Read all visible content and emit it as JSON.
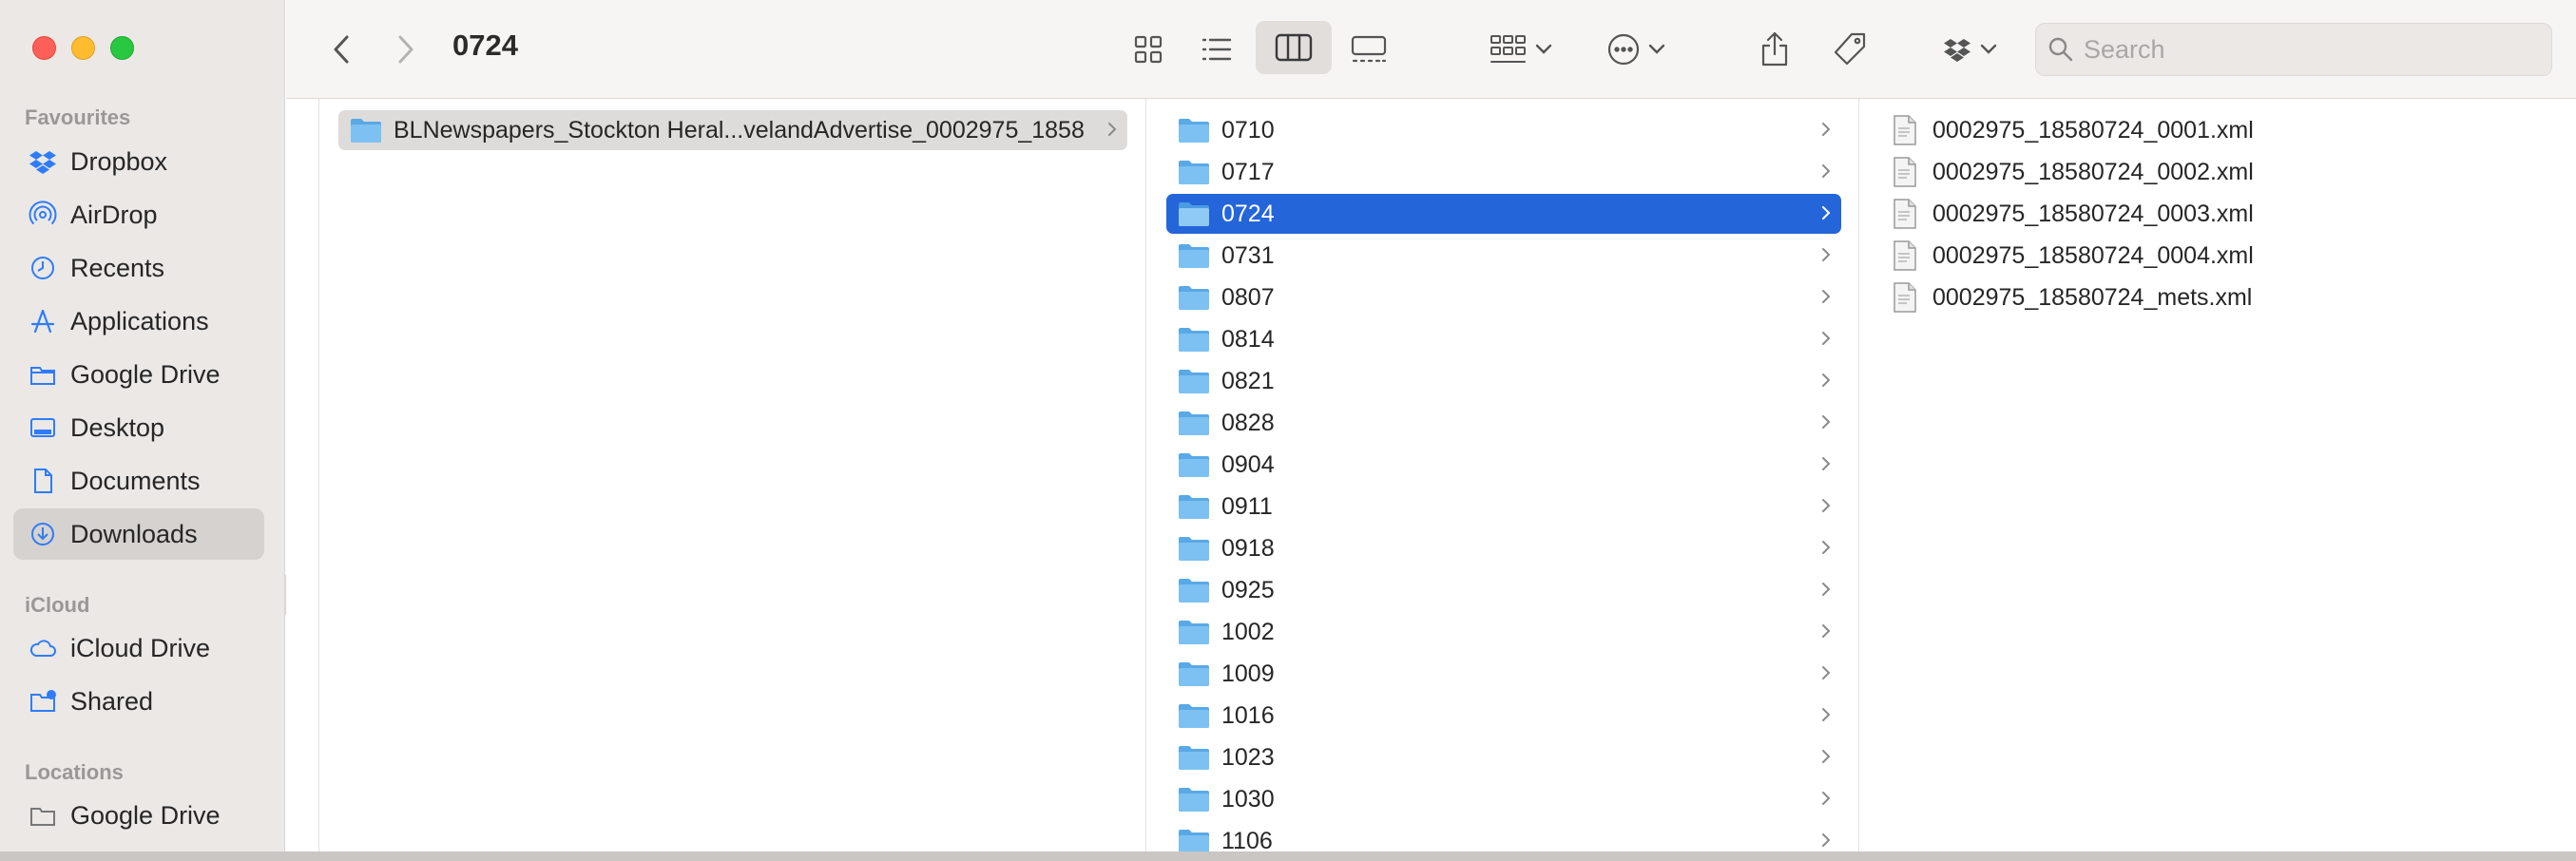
{
  "window": {
    "title": "0724"
  },
  "sidebar": {
    "sections": [
      {
        "heading": "Favourites",
        "items": [
          {
            "label": "Dropbox",
            "icon": "dropbox-icon"
          },
          {
            "label": "AirDrop",
            "icon": "airdrop-icon"
          },
          {
            "label": "Recents",
            "icon": "clock-icon"
          },
          {
            "label": "Applications",
            "icon": "applications-icon"
          },
          {
            "label": "Google Drive",
            "icon": "folder-icon"
          },
          {
            "label": "Desktop",
            "icon": "desktop-icon"
          },
          {
            "label": "Documents",
            "icon": "document-icon"
          },
          {
            "label": "Downloads",
            "icon": "download-icon",
            "selected": true
          }
        ]
      },
      {
        "heading": "iCloud",
        "items": [
          {
            "label": "iCloud Drive",
            "icon": "cloud-icon"
          },
          {
            "label": "Shared",
            "icon": "shared-folder-icon"
          }
        ]
      },
      {
        "heading": "Locations",
        "items": [
          {
            "label": "Google Drive",
            "icon": "drive-icon"
          }
        ]
      }
    ]
  },
  "toolbar": {
    "search_placeholder": "Search"
  },
  "columns": {
    "parent": {
      "items": [
        {
          "name": "BLNewspapers_Stockton Heral...velandAdvertise_0002975_1858",
          "selected": true
        }
      ]
    },
    "months": {
      "items": [
        "0710",
        "0717",
        "0724",
        "0731",
        "0807",
        "0814",
        "0821",
        "0828",
        "0904",
        "0911",
        "0918",
        "0925",
        "1002",
        "1009",
        "1016",
        "1023",
        "1030",
        "1106"
      ],
      "selected": "0724"
    },
    "files": {
      "items": [
        "0002975_18580724_0001.xml",
        "0002975_18580724_0002.xml",
        "0002975_18580724_0003.xml",
        "0002975_18580724_0004.xml",
        "0002975_18580724_mets.xml"
      ]
    }
  },
  "colors": {
    "accent": "#2465d9",
    "sidebar_icon": "#2f7cf6",
    "folder": "#6db7f0"
  }
}
